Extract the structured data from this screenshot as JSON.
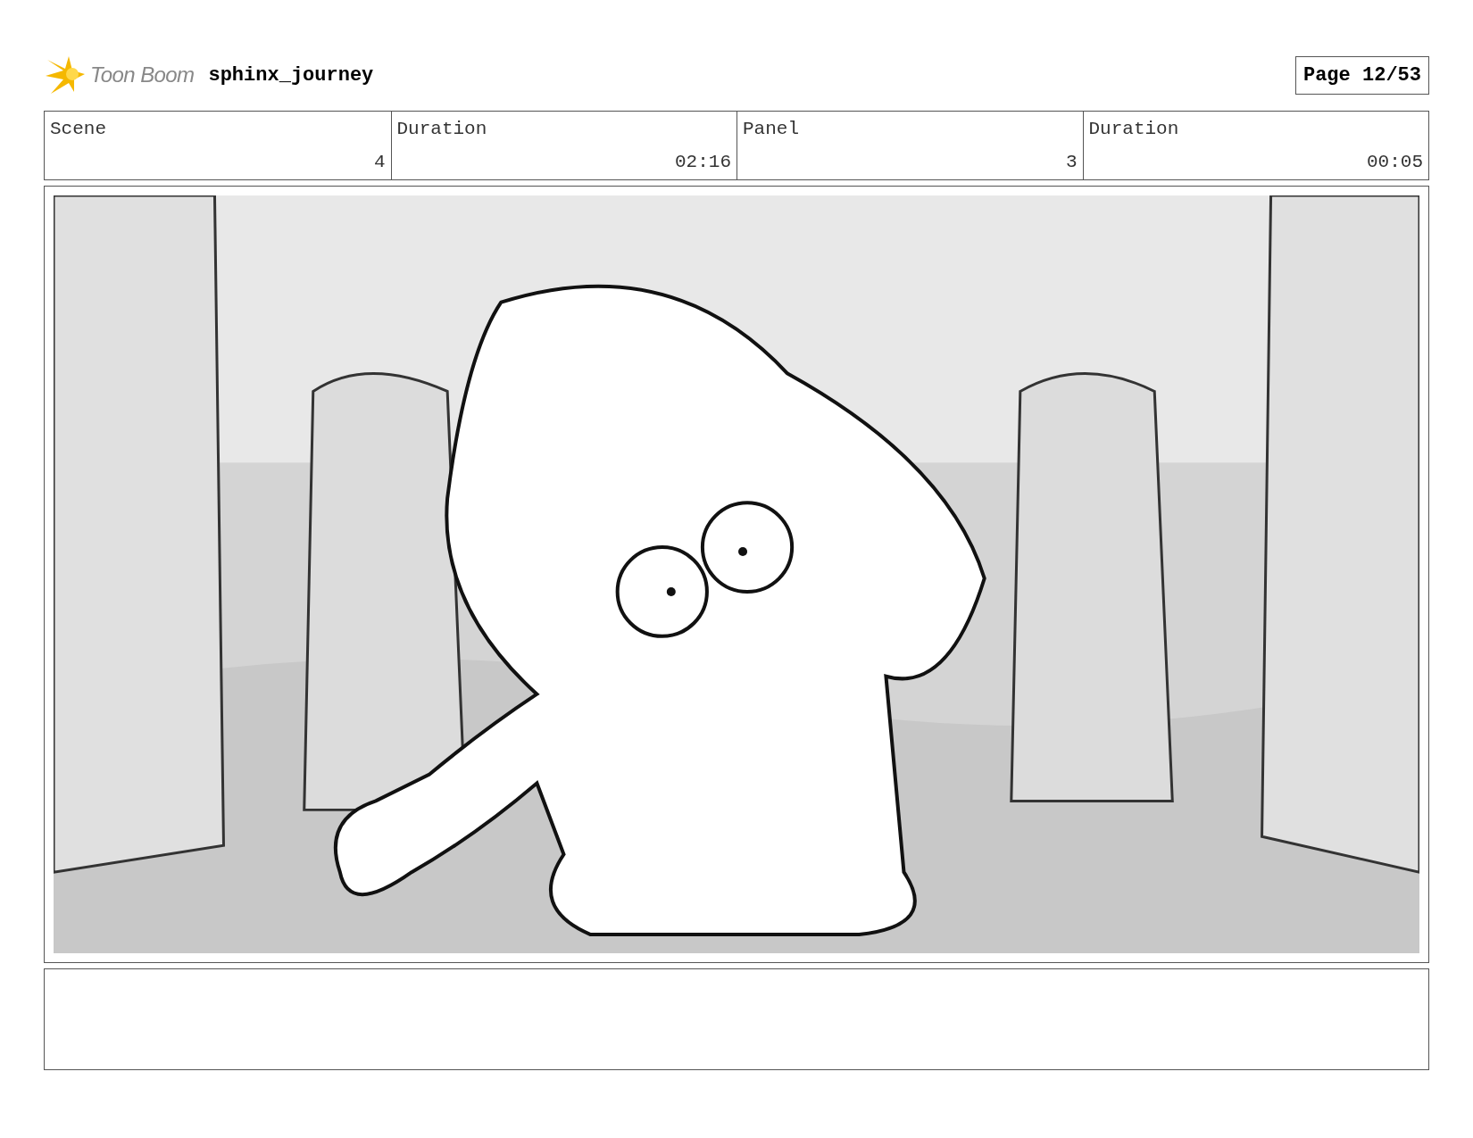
{
  "header": {
    "brand": "Toon Boom",
    "project": "sphinx_journey",
    "page": "Page 12/53"
  },
  "info": {
    "labels": [
      "Scene",
      "Duration",
      "Panel",
      "Duration"
    ],
    "values": [
      "4",
      "02:16",
      "3",
      "00:05"
    ]
  }
}
